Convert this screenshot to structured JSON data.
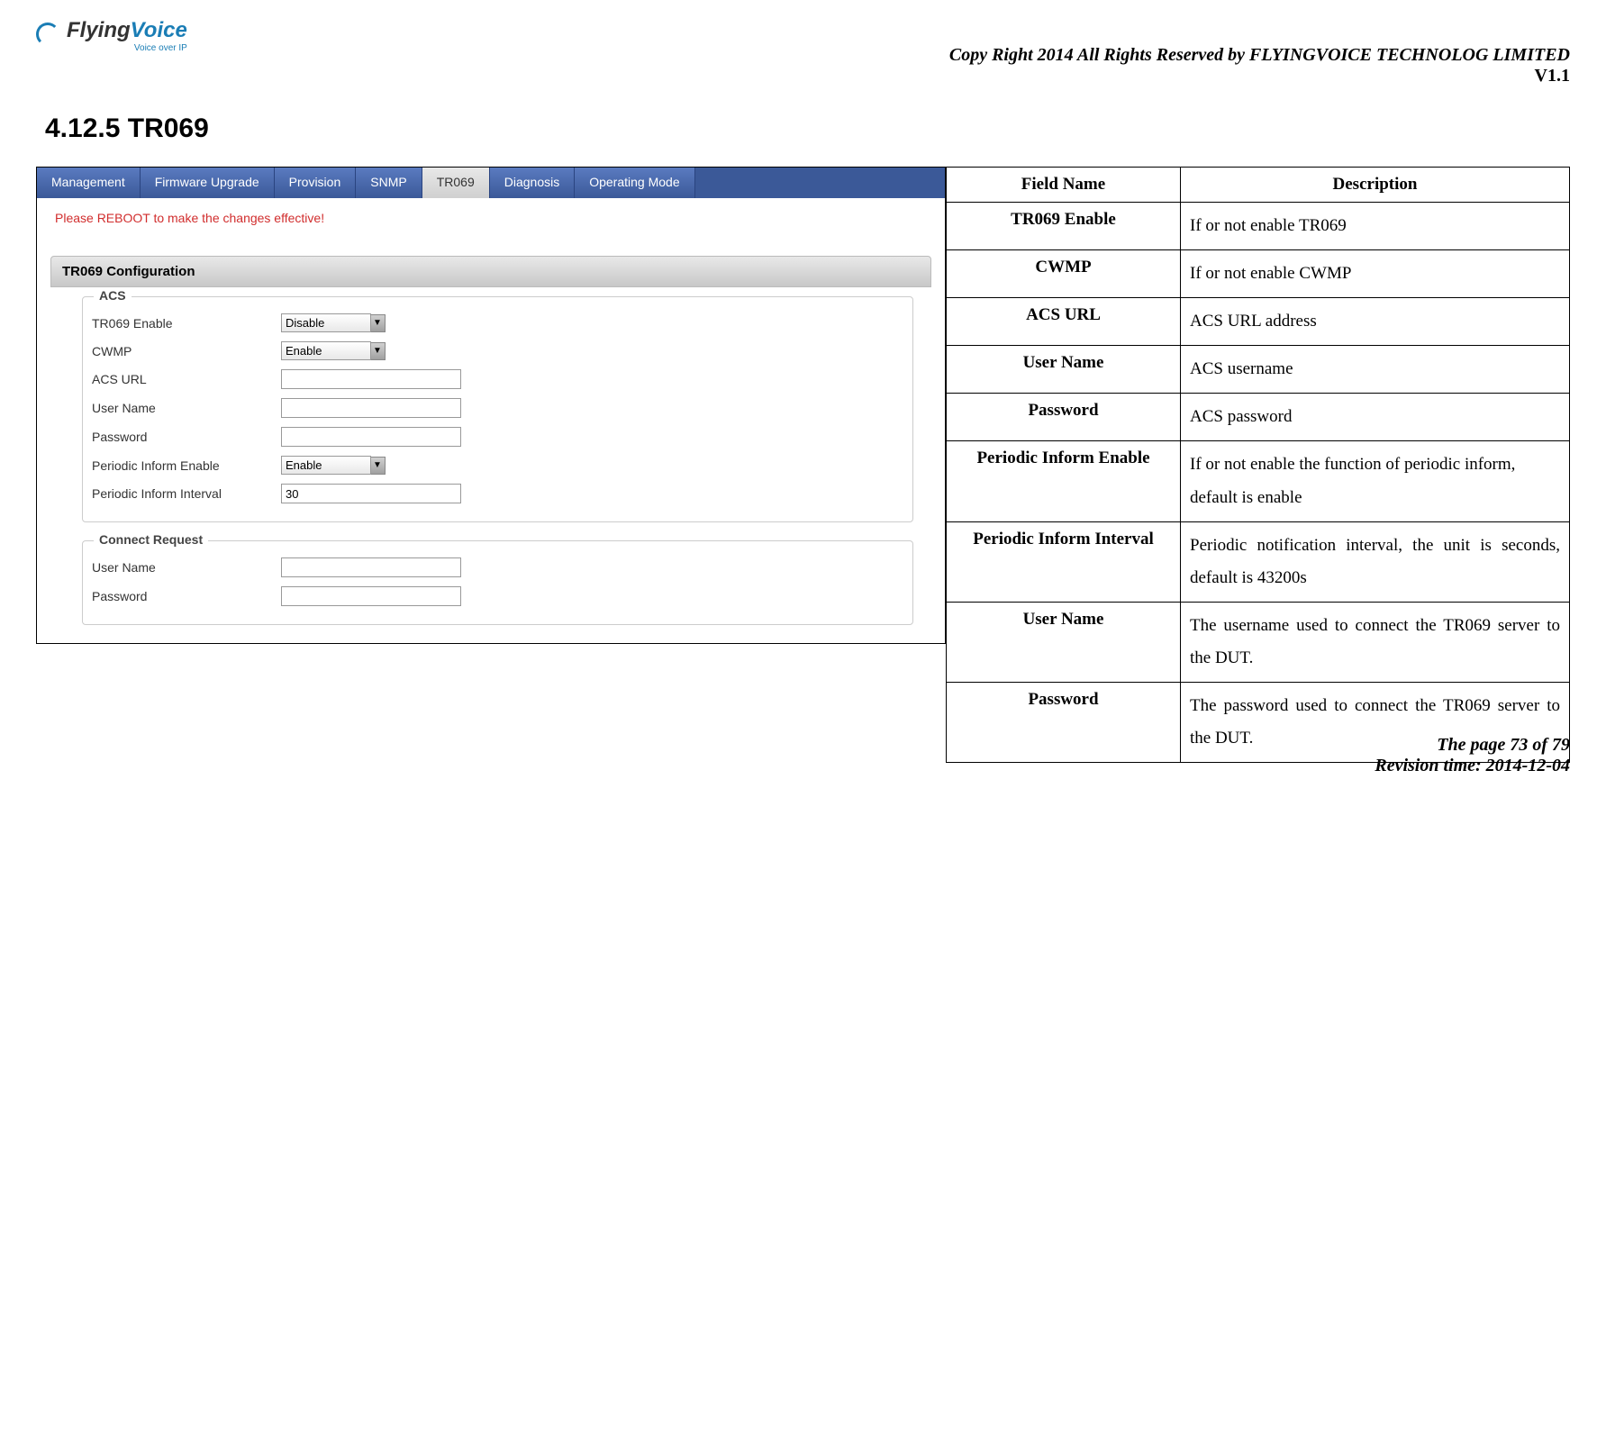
{
  "header": {
    "logo_flying": "Flying",
    "logo_voice": "Voice",
    "logo_sub": "Voice over IP",
    "copyright": "Copy Right 2014 All Rights Reserved by FLYINGVOICE TECHNOLOG LIMITED",
    "version": "V1.1"
  },
  "section_title": "4.12.5  TR069",
  "tabs": [
    {
      "label": "Management",
      "active": false
    },
    {
      "label": "Firmware Upgrade",
      "active": false
    },
    {
      "label": "Provision",
      "active": false
    },
    {
      "label": "SNMP",
      "active": false
    },
    {
      "label": "TR069",
      "active": true
    },
    {
      "label": "Diagnosis",
      "active": false
    },
    {
      "label": "Operating Mode",
      "active": false
    }
  ],
  "reboot_msg": "Please REBOOT to make the changes effective!",
  "config_header": "TR069 Configuration",
  "acs_legend": "ACS",
  "connect_legend": "Connect Request",
  "acs_fields": [
    {
      "label": "TR069 Enable",
      "type": "select",
      "value": "Disable"
    },
    {
      "label": "CWMP",
      "type": "select",
      "value": "Enable"
    },
    {
      "label": "ACS URL",
      "type": "text",
      "value": ""
    },
    {
      "label": "User Name",
      "type": "text",
      "value": ""
    },
    {
      "label": "Password",
      "type": "text",
      "value": ""
    },
    {
      "label": "Periodic Inform Enable",
      "type": "select",
      "value": "Enable"
    },
    {
      "label": "Periodic Inform Interval",
      "type": "text",
      "value": "30"
    }
  ],
  "connect_fields": [
    {
      "label": "User Name",
      "type": "text",
      "value": ""
    },
    {
      "label": "Password",
      "type": "text",
      "value": ""
    }
  ],
  "desc_header": {
    "field": "Field Name",
    "desc": "Description"
  },
  "desc_rows": [
    {
      "field": "TR069 Enable",
      "desc": "If or not enable TR069"
    },
    {
      "field": "CWMP",
      "desc": "If or not enable CWMP"
    },
    {
      "field": "ACS URL",
      "desc": "ACS URL address"
    },
    {
      "field": "User Name",
      "desc": "ACS username"
    },
    {
      "field": "Password",
      "desc": "ACS password"
    },
    {
      "field": "Periodic Inform Enable",
      "desc": "If or not enable the function of periodic inform, default is enable"
    },
    {
      "field": "Periodic Inform Interval",
      "desc": "Periodic notification interval, the unit is seconds, default is 43200s"
    },
    {
      "field": "User Name",
      "desc": "The username used to connect the TR069 server to the DUT."
    },
    {
      "field": "Password",
      "desc": "The password used to connect the TR069 server to the DUT."
    }
  ],
  "footer": {
    "page": "The page 73 of 79",
    "revision": "Revision time: 2014-12-04"
  }
}
